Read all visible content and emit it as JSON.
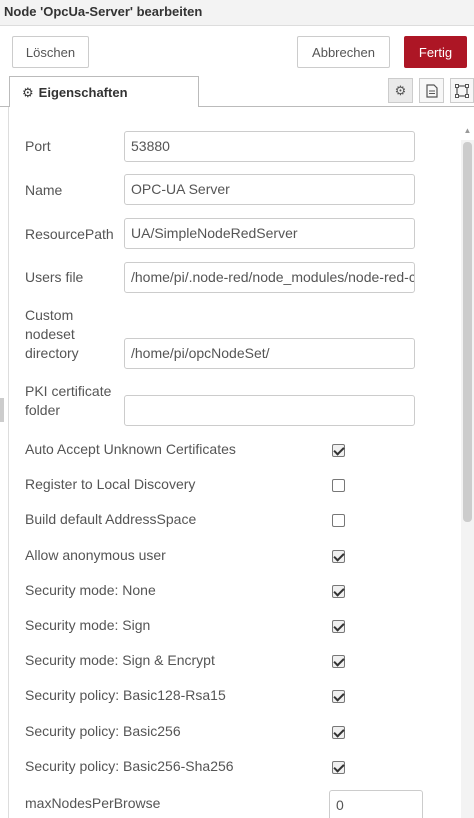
{
  "dialog": {
    "title": "Node 'OpcUa-Server' bearbeiten",
    "delete_label": "Löschen",
    "cancel_label": "Abbrechen",
    "done_label": "Fertig",
    "accent_color": "#ad1625"
  },
  "tabs": {
    "properties_label": "Eigenschaften"
  },
  "fields": {
    "port": {
      "label": "Port",
      "value": "53880"
    },
    "name": {
      "label": "Name",
      "value": "OPC-UA Server"
    },
    "resource_path": {
      "label": "ResourcePath",
      "value": "UA/SimpleNodeRedServer"
    },
    "users_file": {
      "label": "Users file",
      "value": "/home/pi/.node-red/node_modules/node-red-co"
    },
    "custom_nodeset": {
      "label_line1": "Custom",
      "label_line2": "nodeset",
      "label_line3": "directory",
      "value": "/home/pi/opcNodeSet/"
    },
    "pki_folder": {
      "label_line1": "PKI certificate",
      "label_line2": "folder",
      "value": ""
    },
    "max_nodes": {
      "label": "maxNodesPerBrowse",
      "value": "0"
    }
  },
  "checkboxes": [
    {
      "label": "Auto Accept Unknown Certificates",
      "checked": true
    },
    {
      "label": "Register to Local Discovery",
      "checked": false
    },
    {
      "label": "Build default AddressSpace",
      "checked": false
    },
    {
      "label": "Allow anonymous user",
      "checked": true
    },
    {
      "label": "Security mode: None",
      "checked": true
    },
    {
      "label": "Security mode: Sign",
      "checked": true
    },
    {
      "label": "Security mode: Sign & Encrypt",
      "checked": true
    },
    {
      "label": "Security policy: Basic128-Rsa15",
      "checked": true
    },
    {
      "label": "Security policy: Basic256",
      "checked": true
    },
    {
      "label": "Security policy: Basic256-Sha256",
      "checked": true
    }
  ]
}
